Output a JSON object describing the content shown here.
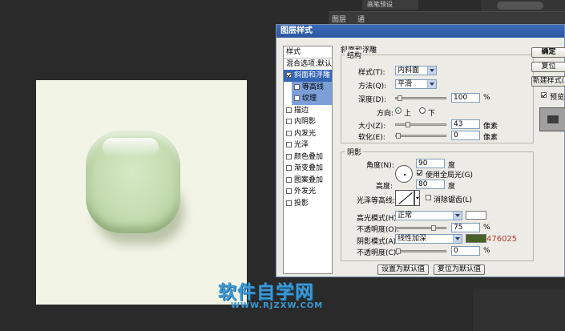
{
  "bg": {
    "brush_tab": "画笔预设",
    "panel_tabs": [
      "图层",
      "通"
    ]
  },
  "watermark": {
    "main": "软件自学网",
    "url": "WWW.RJZXW.COM"
  },
  "dialog": {
    "title": "图层样式",
    "list": {
      "header": "样式",
      "blend": "混合选项:默认",
      "items": [
        {
          "label": "斜面和浮雕",
          "checked": true
        },
        {
          "label": "等高线",
          "checked": false,
          "sub": true
        },
        {
          "label": "纹理",
          "checked": false,
          "sub": true
        },
        {
          "label": "描边",
          "checked": false
        },
        {
          "label": "内阴影",
          "checked": false
        },
        {
          "label": "内发光",
          "checked": false
        },
        {
          "label": "光泽",
          "checked": false
        },
        {
          "label": "颜色叠加",
          "checked": false
        },
        {
          "label": "渐变叠加",
          "checked": false
        },
        {
          "label": "图案叠加",
          "checked": false
        },
        {
          "label": "外发光",
          "checked": false
        },
        {
          "label": "投影",
          "checked": false
        }
      ]
    },
    "bevel": {
      "section": "斜面和浮雕",
      "structure": "结构",
      "style_label": "样式(T):",
      "style_value": "内斜面",
      "method_label": "方法(Q):",
      "method_value": "平滑",
      "depth_label": "深度(D):",
      "depth_value": "100",
      "depth_unit": "%",
      "direction_label": "方向:",
      "dir_up": "上",
      "dir_down": "下",
      "size_label": "大小(Z):",
      "size_value": "43",
      "size_unit": "像素",
      "soften_label": "软化(E):",
      "soften_value": "0",
      "soften_unit": "像素"
    },
    "shading": {
      "section": "阴影",
      "angle_label": "角度(N):",
      "angle_value": "90",
      "angle_unit": "度",
      "global_light": "使用全局光(G)",
      "altitude_label": "高度:",
      "altitude_value": "80",
      "altitude_unit": "度",
      "gloss_label": "光泽等高线:",
      "antialias": "消除锯齿(L)",
      "highlight_label": "高光模式(H):",
      "highlight_value": "正常",
      "highlight_color": "#ffffff",
      "opacity1_label": "不透明度(O):",
      "opacity1_value": "75",
      "opacity1_unit": "%",
      "shadow_label": "阴影模式(A):",
      "shadow_value": "线性加深",
      "shadow_color": "#476025",
      "shadow_hex_note": "476025",
      "opacity2_label": "不透明度(C):",
      "opacity2_value": "0",
      "opacity2_unit": "%"
    },
    "buttons": {
      "set_default": "设置为默认值",
      "reset_default": "复位为默认值",
      "ok": "确定",
      "reset": "复位",
      "new_style": "新建样式(",
      "preview": "预览("
    }
  }
}
